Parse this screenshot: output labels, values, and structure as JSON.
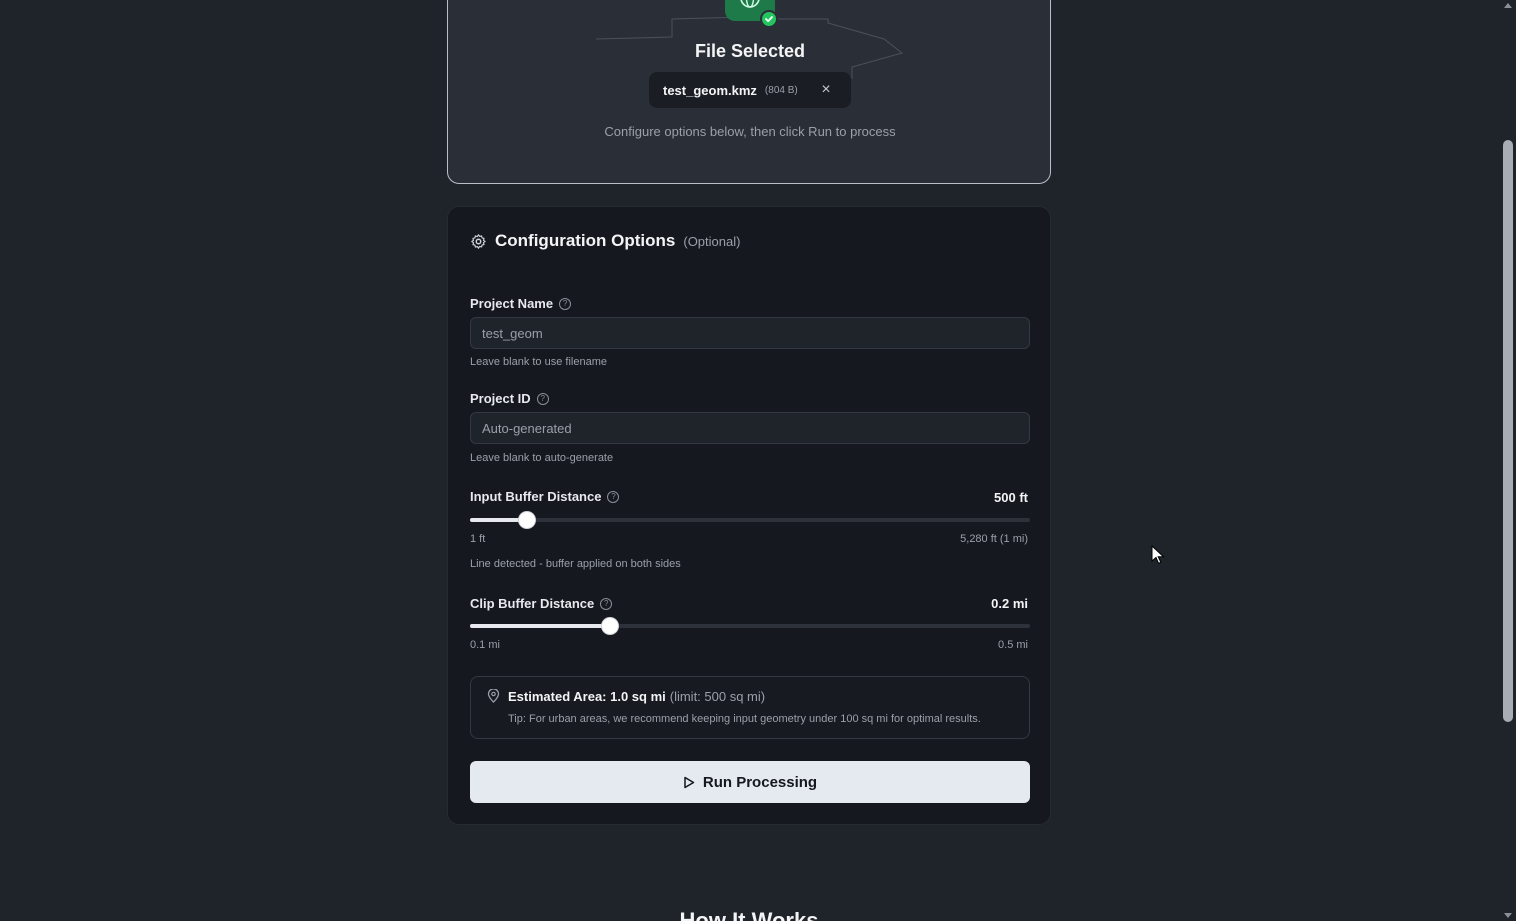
{
  "upload": {
    "title": "File Selected",
    "file_name": "test_geom.kmz",
    "file_size": "(804 B)",
    "hint": "Configure options below, then click Run to process",
    "close_glyph": "×"
  },
  "config": {
    "title": "Configuration Options",
    "optional": "(Optional)",
    "project_name": {
      "label": "Project Name",
      "placeholder": "test_geom",
      "help": "Leave blank to use filename"
    },
    "project_id": {
      "label": "Project ID",
      "placeholder": "Auto-generated",
      "help": "Leave blank to auto-generate"
    },
    "input_buffer": {
      "label": "Input Buffer Distance",
      "value_label": "500 ft",
      "value": 500,
      "min_label": "1 ft",
      "max_label": "5,280 ft (1 mi)",
      "min": 1,
      "max": 5280,
      "help": "Line detected - buffer applied on both sides"
    },
    "clip_buffer": {
      "label": "Clip Buffer Distance",
      "value_label": "0.2 mi",
      "value": 0.2,
      "min_label": "0.1 mi",
      "max_label": "0.5 mi",
      "min": 0.1,
      "max": 0.5
    },
    "estimate": {
      "label": "Estimated Area: 1.0 sq mi",
      "limit": "(limit: 500 sq mi)",
      "tip": "Tip: For urban areas, we recommend keeping input geometry under 100 sq mi for optimal results."
    },
    "run_label": "Run Processing"
  },
  "bottom_heading": "How It Works",
  "help_glyph": "?",
  "icons": [
    "globe-icon",
    "check-icon",
    "close-icon",
    "gear-icon",
    "help-icon",
    "map-pin-icon",
    "play-icon"
  ],
  "colors": {
    "background": "#1f232a",
    "card": "#15181e",
    "accent_green": "#22c55e",
    "button": "#e5e9f0"
  }
}
